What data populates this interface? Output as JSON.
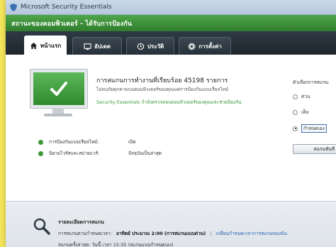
{
  "window": {
    "title": "Microsoft Security Essentials"
  },
  "status_bar": {
    "text": "สถานะของคอมพิวเตอร์ - ได้รับการป้องกัน"
  },
  "tabs": [
    {
      "label": "หน้าแรก",
      "icon": "home-icon",
      "active": true
    },
    {
      "label": "อัปเดต",
      "icon": "update-icon",
      "active": false
    },
    {
      "label": "ประวัติ",
      "icon": "history-icon",
      "active": false
    },
    {
      "label": "การตั้งค่า",
      "icon": "settings-icon",
      "active": false
    }
  ],
  "main": {
    "headline": "การสแกนการทำงานที่เรียบร้อย 45198 รายการ",
    "subline": "ไม่พบภัยคุกคามบนคอมพิวเตอร์ของคุณแต่การป้องกันแบบเรียลไทม์",
    "green_note": "Security Essentials กำลังตรวจสอบคอมพิวเตอร์ของคุณและช่วยป้องกัน",
    "status_rows": [
      {
        "label": "การป้องกันแบบเรียลไทม์:",
        "value": "เปิด"
      },
      {
        "label": "นิยามไวรัสและสปายแวร์:",
        "value": "ปัจจุบันเป็นล่าสุด"
      }
    ],
    "scan_options": {
      "title": "ตัวเลือกการสแกน:",
      "options": [
        {
          "label": "ด่วน",
          "selected": false
        },
        {
          "label": "เต็ม",
          "selected": false
        },
        {
          "label": "กำหนดเอง",
          "selected": true
        }
      ],
      "button_label": "สแกนทันที"
    }
  },
  "footer": {
    "title": "รายละเอียดการสแกน",
    "schedule_label": "การสแกนตามกำหนดเวลา:",
    "schedule_value": "อาทิตย์ ประมาณ 2:00 (การสแกนแบบด่วน)",
    "change_link": "เปลี่ยนกำหนดเวลาการสแกนของฉัน",
    "last_scan": "สแกนครั้งล่าสุด: วันนี้ เวลา 15:35 (สแกนแบบกำหนดเอง)"
  },
  "colors": {
    "status_green": "#3a9a37",
    "tab_dark": "#252e36",
    "accent_blue": "#2563ae"
  }
}
